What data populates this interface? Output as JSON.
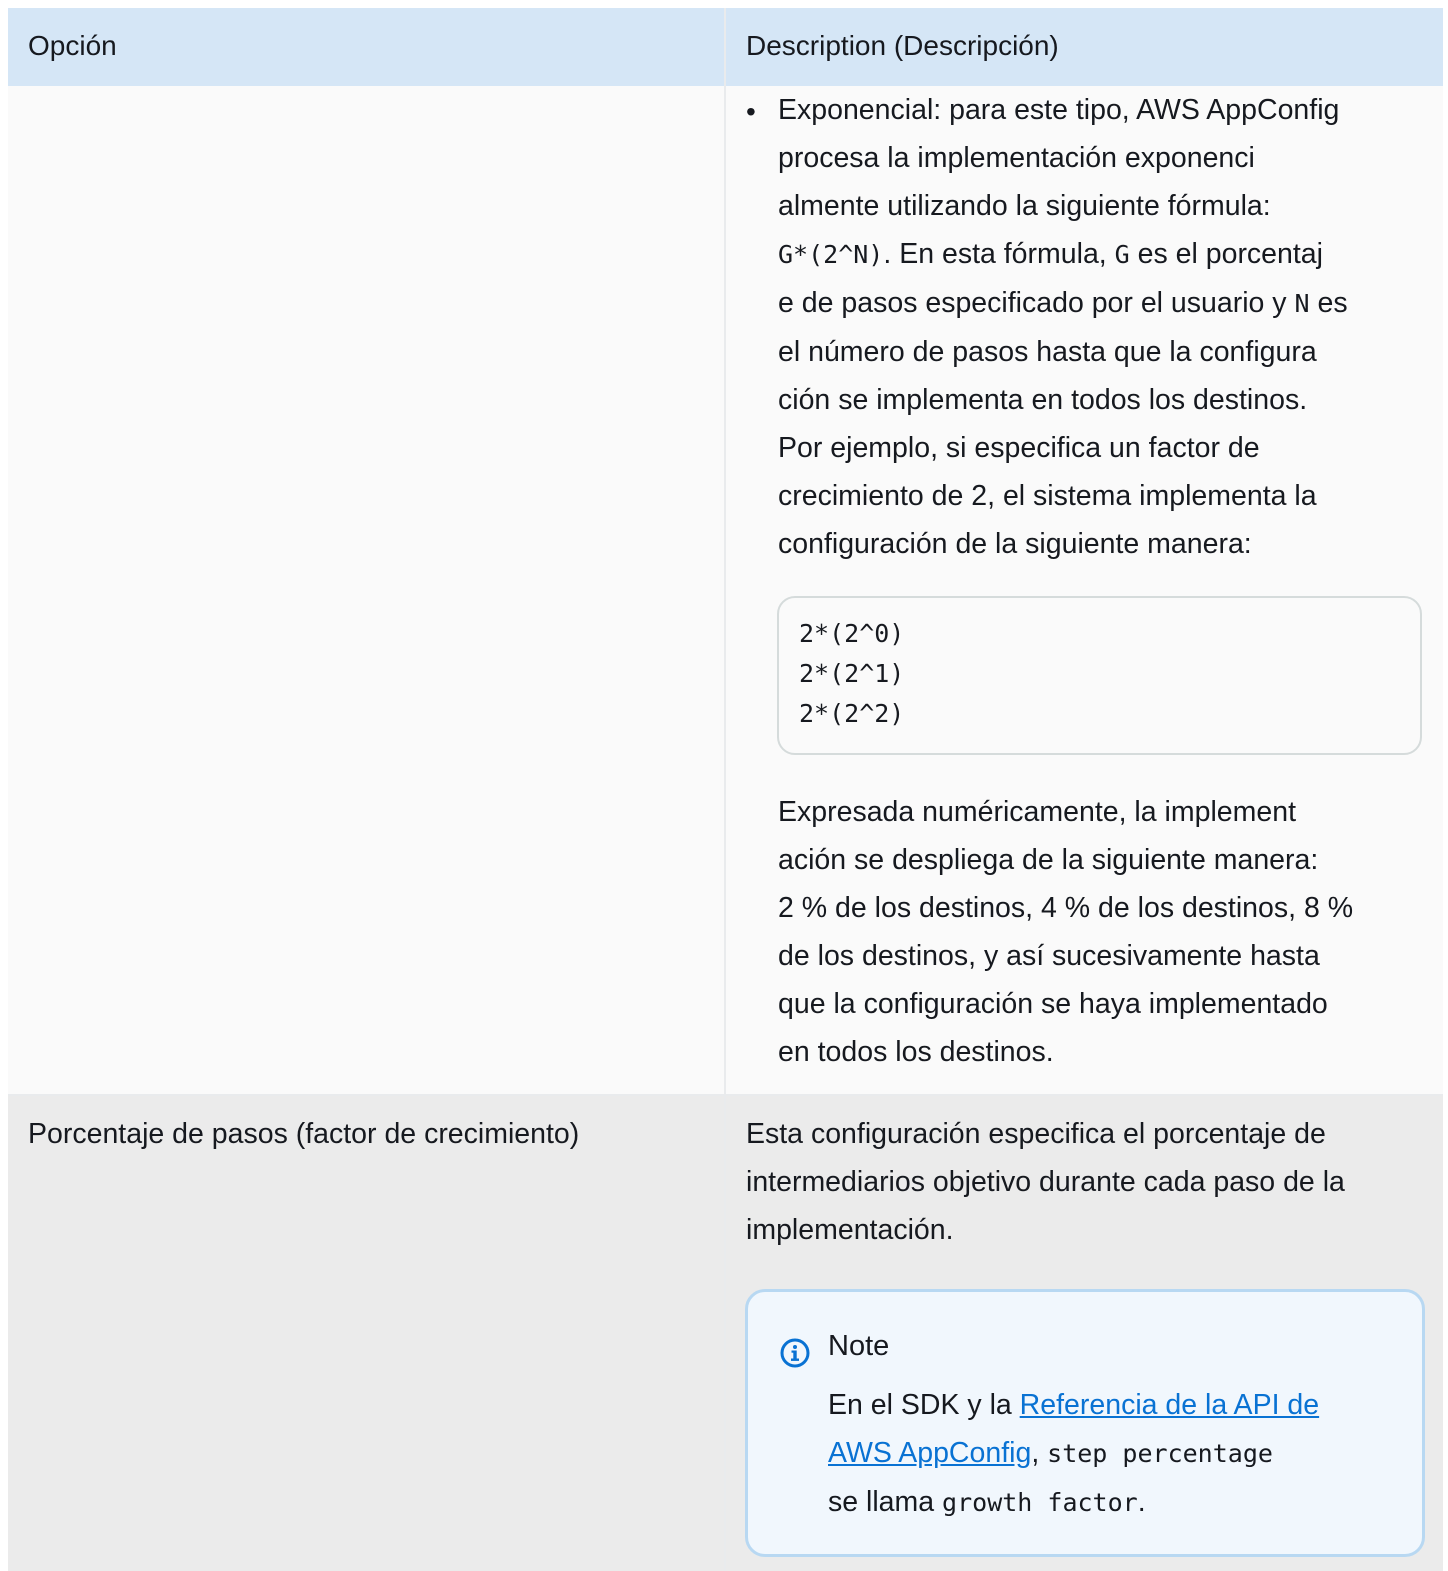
{
  "header": {
    "col1": "Opción",
    "col2": "Description (Descripción)"
  },
  "row1": {
    "option": "",
    "bullet": "•",
    "paragraph1_lines": [
      "Exponencial: para este tipo, AWS AppConfig",
      " procesa la implementación exponenci",
      "almente utilizando la siguiente fórmula:",
      "G*(2^N). En esta fórmula, G es el porcentaj",
      "e de pasos especificado por el usuario y N es",
      "el número de pasos hasta que la configura",
      "ción se implementa en todos los destinos.",
      "Por ejemplo, si especifica un factor de",
      "crecimiento de 2, el sistema implementa la",
      "configuración de la siguiente manera:"
    ],
    "code_lines": [
      "2*(2^0)",
      "2*(2^1)",
      "2*(2^2)"
    ],
    "paragraph2_lines": [
      "Expresada numéricamente, la implement",
      "ación se despliega de la siguiente manera:",
      "2 % de los destinos, 4 % de los destinos, 8 %",
      "de los destinos, y así sucesivamente hasta",
      "que la configuración se haya implementado",
      "en todos los destinos."
    ]
  },
  "row2": {
    "option": "Porcentaje de pasos (factor de crecimiento)",
    "description_lines": [
      "Esta configuración especifica el porcentaje de",
      "intermediarios objetivo durante cada paso de la",
      "implementación."
    ],
    "note": {
      "icon": "info-icon",
      "title": "Note",
      "text_before_link": "En el SDK y la ",
      "link_line1": "Referencia de la API de",
      "link_line2": "AWS AppConfig",
      "after_link": ", ",
      "code1": "step percentage",
      "text_mid": "se llama ",
      "code2": "growth factor",
      "text_end": "."
    }
  },
  "colors": {
    "header_bg": "#d5e6f6",
    "row1_bg": "#fafafa",
    "row2_bg": "#ebebeb",
    "note_bg": "#f1f7fd",
    "note_border": "#b8d8f2",
    "link": "#0972d3",
    "info_icon": "#0972d3"
  }
}
